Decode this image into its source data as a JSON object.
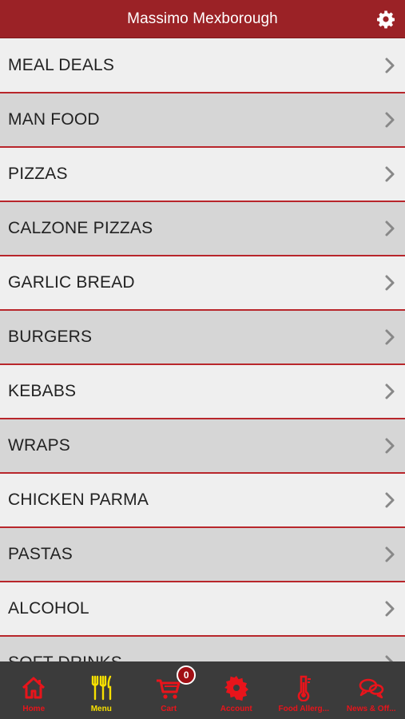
{
  "header": {
    "title": "Massimo Mexborough",
    "settings_icon": "gear-icon"
  },
  "menu": {
    "items": [
      {
        "label": "MEAL DEALS"
      },
      {
        "label": "MAN FOOD"
      },
      {
        "label": "PIZZAS"
      },
      {
        "label": "CALZONE PIZZAS"
      },
      {
        "label": "GARLIC BREAD"
      },
      {
        "label": "BURGERS"
      },
      {
        "label": "KEBABS"
      },
      {
        "label": "WRAPS"
      },
      {
        "label": "CHICKEN PARMA"
      },
      {
        "label": "PASTAS"
      },
      {
        "label": "ALCOHOL"
      },
      {
        "label": "SOFT DRINKS"
      }
    ]
  },
  "tabbar": {
    "tabs": [
      {
        "label": "Home",
        "icon": "home-icon"
      },
      {
        "label": "Menu",
        "icon": "fork-knife-icon"
      },
      {
        "label": "Cart",
        "icon": "cart-icon",
        "badge": "0"
      },
      {
        "label": "Account",
        "icon": "gear-badge-icon"
      },
      {
        "label": "Food Allerg...",
        "icon": "thermometer-icon"
      },
      {
        "label": "News & Off...",
        "icon": "chat-bubbles-icon"
      }
    ],
    "active_index": 1
  },
  "colors": {
    "brand_red": "#9b2226",
    "row_border": "#b8262b",
    "tab_bar": "#3b3b3b",
    "tab_inactive": "#e8141b",
    "tab_active": "#f7e000"
  }
}
